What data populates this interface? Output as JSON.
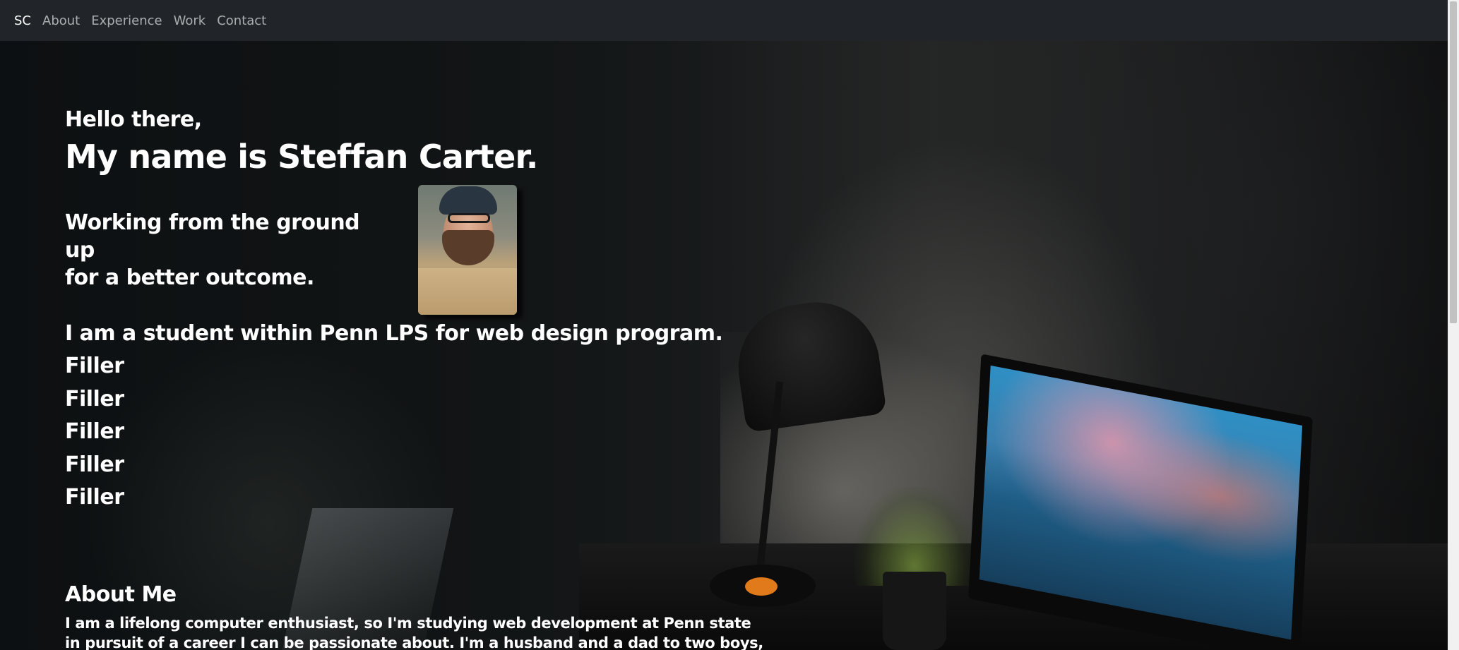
{
  "navbar": {
    "brand": "SC",
    "links": [
      "About",
      "Experience",
      "Work",
      "Contact"
    ]
  },
  "hero": {
    "greeting": "Hello there,",
    "name": "My name is Steffan Carter.",
    "tagline_line1": "Working from the ground up",
    "tagline_line2": "for a better outcome.",
    "student_line": "I am a student within Penn LPS for web design program.",
    "fillers": [
      "Filler",
      "Filler",
      "Filler",
      "Filler",
      "Filler"
    ]
  },
  "about": {
    "heading": "About Me",
    "text": "I am a lifelong computer enthusiast, so I'm studying web development at Penn state in pursuit of a career I can be passionate about. I'm a husband and a dad to two boys, and in"
  },
  "colors": {
    "navbar_bg": "#212529",
    "nav_link": "#a6a8aa",
    "text": "#ffffff"
  },
  "icons": {
    "portrait": "profile-photo"
  }
}
